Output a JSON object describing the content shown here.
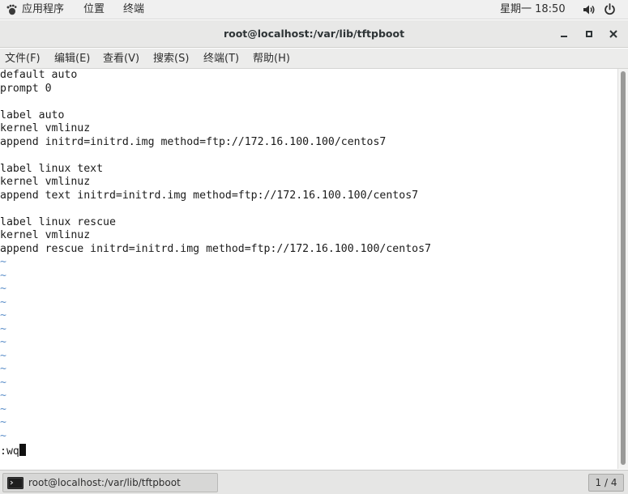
{
  "topbar": {
    "apps": "应用程序",
    "places": "位置",
    "terminal": "终端",
    "clock": "星期一 18:50"
  },
  "window": {
    "title": "root@localhost:/var/lib/tftpboot",
    "minimize_glyph": "_",
    "close_glyph": "×"
  },
  "menubar": {
    "file": "文件(F)",
    "edit": "编辑(E)",
    "view": "查看(V)",
    "search": "搜索(S)",
    "terminal": "终端(T)",
    "help": "帮助(H)"
  },
  "terminal": {
    "lines": [
      "default auto",
      "prompt 0",
      "",
      "label auto",
      "kernel vmlinuz",
      "append initrd=initrd.img method=ftp://172.16.100.100/centos7",
      "",
      "label linux text",
      "kernel vmlinuz",
      "append text initrd=initrd.img method=ftp://172.16.100.100/centos7",
      "",
      "label linux rescue",
      "kernel vmlinuz",
      "append rescue initrd=initrd.img method=ftp://172.16.100.100/centos7"
    ],
    "tilde_glyph": "~",
    "tilde_count": 14,
    "command": ":wq"
  },
  "taskbar": {
    "item_label": "root@localhost:/var/lib/tftpboot",
    "pager": "1 / 4"
  },
  "colors": {
    "tilde": "#5b8ec9",
    "text": "#1b1b1b",
    "topbar_bg": "#f0f0f0"
  },
  "icons": {
    "apps": "gnome-foot-icon",
    "volume": "volume-icon",
    "power": "power-icon",
    "minimize": "minimize-icon",
    "maximize": "maximize-icon",
    "close": "close-icon",
    "task": "terminal-icon"
  }
}
